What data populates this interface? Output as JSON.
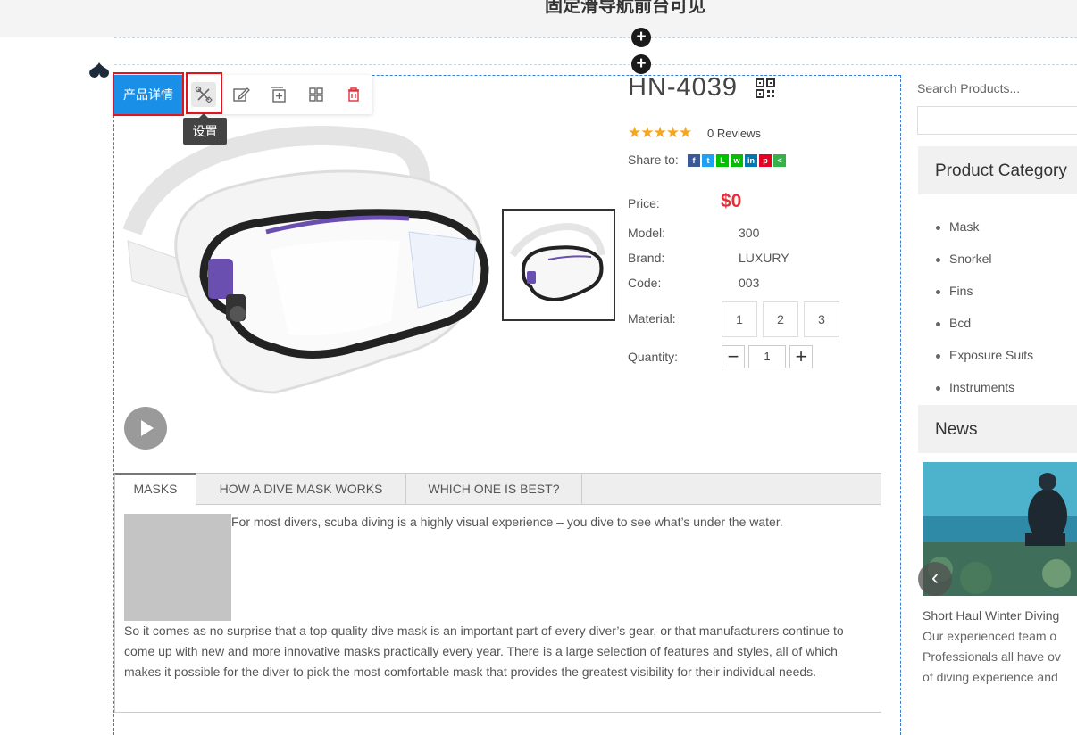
{
  "header": {
    "title": "固定滑导航前台可见"
  },
  "toolbar": {
    "module_label": "产品详情",
    "settings_tooltip": "设置",
    "icons": [
      "settings-icon",
      "edit-icon",
      "add-icon",
      "layout-icon",
      "delete-icon"
    ]
  },
  "product": {
    "title": "HN-4039",
    "stars": "★★★★★",
    "reviews": "0 Reviews",
    "share_label": "Share to:",
    "share_icons": [
      {
        "name": "facebook",
        "glyph": "f",
        "color": "#3b5998"
      },
      {
        "name": "twitter",
        "glyph": "t",
        "color": "#1da1f2"
      },
      {
        "name": "line",
        "glyph": "L",
        "color": "#00c300"
      },
      {
        "name": "wechat",
        "glyph": "w",
        "color": "#09bb07"
      },
      {
        "name": "linkedin",
        "glyph": "in",
        "color": "#0077b5"
      },
      {
        "name": "pinterest",
        "glyph": "p",
        "color": "#e60023"
      },
      {
        "name": "sharethis",
        "glyph": "<",
        "color": "#36b24a"
      }
    ],
    "price_label": "Price:",
    "price": "$0",
    "model_label": "Model:",
    "model": "300",
    "brand_label": "Brand:",
    "brand": "LUXURY",
    "code_label": "Code:",
    "code": "003",
    "material_label": "Material:",
    "materials": [
      "1",
      "2",
      "3"
    ],
    "quantity_label": "Quantity:",
    "quantity": "1",
    "minus": "−",
    "plus": "+"
  },
  "tabs": [
    "MASKS",
    "HOW A DIVE MASK WORKS",
    "WHICH ONE IS BEST?"
  ],
  "description": {
    "intro": "For most divers, scuba diving is a highly visual experience – you dive to see what’s under the water.",
    "body": "So it comes as no surprise that a top-quality dive mask is an important part of every diver’s gear, or that manufacturers continue to come up with new and more innovative masks practically every year. There is a large selection of features and styles, all of which makes it possible for the diver to pick the most comfortable mask that provides the greatest visibility for their individual needs."
  },
  "sidebar": {
    "search_placeholder": "Search Products...",
    "category_heading": "Product Category",
    "categories": [
      "Mask",
      "Snorkel",
      "Fins",
      "Bcd",
      "Exposure Suits",
      "Instruments"
    ],
    "news_heading": "News",
    "news_title": "Short Haul Winter Diving",
    "news_lines": [
      "Our experienced team o",
      "Professionals all have ov",
      "of diving experience and"
    ]
  },
  "colors": {
    "accent": "#1a8fe8",
    "price": "#e0313b",
    "highlight": "#e0141c",
    "stars": "#f5a623"
  }
}
